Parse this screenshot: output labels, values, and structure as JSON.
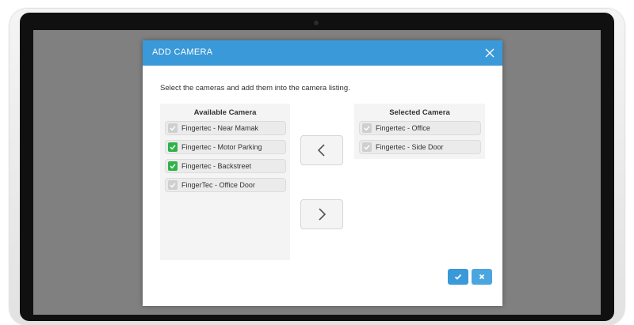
{
  "modal": {
    "title": "ADD CAMERA",
    "instruction": "Select the cameras and add them into the camera listing."
  },
  "available": {
    "title": "Available Camera",
    "items": [
      {
        "label": "Fingertec - Near Mamak",
        "checked": false
      },
      {
        "label": "Fingertec - Motor Parking",
        "checked": true
      },
      {
        "label": "Fingertec - Backstreet",
        "checked": true
      },
      {
        "label": "FingerTec - Office Door",
        "checked": false
      }
    ]
  },
  "selected": {
    "title": "Selected Camera",
    "items": [
      {
        "label": "Fingertec - Office",
        "checked": false
      },
      {
        "label": "Fingertec - Side Door",
        "checked": false
      }
    ]
  },
  "icons": {
    "close": "close-icon",
    "move_left": "chevron-left-icon",
    "move_right": "chevron-right-icon",
    "confirm": "check-icon",
    "cancel": "x-icon"
  },
  "colors": {
    "header": "#3a99d8",
    "checked": "#2fb349",
    "unchecked": "#cfcfcf",
    "overlay": "#808080"
  }
}
